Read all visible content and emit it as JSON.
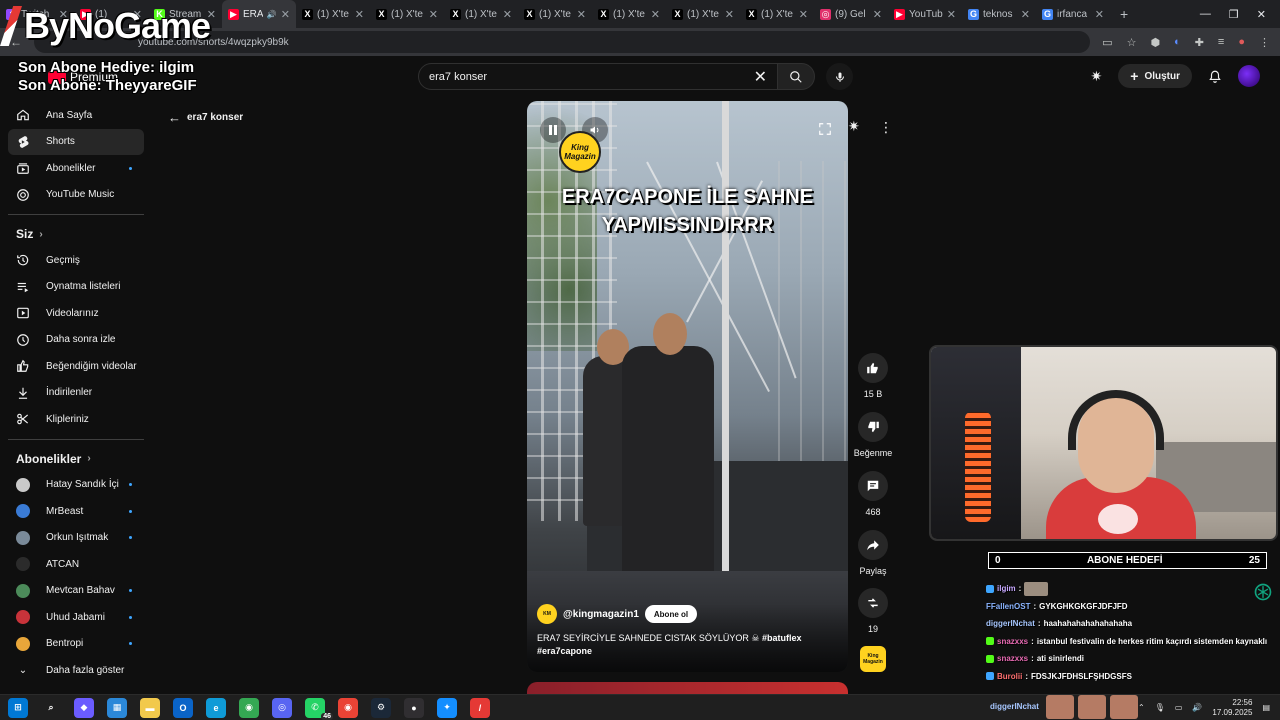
{
  "browser": {
    "tabs": [
      {
        "label": "Twitch",
        "icon": "twitch-icon",
        "color": "#9147ff"
      },
      {
        "label": "(1)",
        "icon": "youtube-icon",
        "color": "#ff0033"
      },
      {
        "label": "Stream",
        "icon": "kick-icon",
        "color": "#53fc18"
      },
      {
        "label": "ERA",
        "icon": "youtube-icon",
        "color": "#ff0033",
        "active": true
      },
      {
        "label": "(1) X'te",
        "icon": "x-icon",
        "color": "#000000"
      },
      {
        "label": "(1) X'te",
        "icon": "x-icon",
        "color": "#000000"
      },
      {
        "label": "(1) X'te",
        "icon": "x-icon",
        "color": "#000000"
      },
      {
        "label": "(1) X'te",
        "icon": "x-icon",
        "color": "#000000"
      },
      {
        "label": "(1) X'te",
        "icon": "x-icon",
        "color": "#000000"
      },
      {
        "label": "(1) X'te",
        "icon": "x-icon",
        "color": "#000000"
      },
      {
        "label": "(1) X'te",
        "icon": "x-icon",
        "color": "#000000"
      },
      {
        "label": "(9) Gel",
        "icon": "instagram-icon",
        "color": "#e1306c"
      },
      {
        "label": "YouTub",
        "icon": "youtube-icon",
        "color": "#ff0033"
      },
      {
        "label": "teknos",
        "icon": "google-icon",
        "color": "#4285f4"
      },
      {
        "label": "irfanca",
        "icon": "google-icon",
        "color": "#4285f4"
      }
    ],
    "url": "youtube.com/shorts/4wqzpky9b9k"
  },
  "overlay": {
    "brand": "ByNoGame",
    "last_donation": "Son Abone Hediye: ilgim",
    "last_sub": "Son Abone: TheyyareGIF"
  },
  "youtube": {
    "logo_text": "Premium",
    "search_value": "era7 konser",
    "create_label": "Oluştur",
    "back_label": "era7 konser",
    "accent": "#ff0033"
  },
  "sidebar": {
    "main": [
      {
        "label": "Ana Sayfa",
        "icon": "home-icon"
      },
      {
        "label": "Shorts",
        "icon": "shorts-icon",
        "active": true
      },
      {
        "label": "Abonelikler",
        "icon": "subscriptions-icon",
        "dot": true
      },
      {
        "label": "YouTube Music",
        "icon": "music-icon"
      }
    ],
    "you_header": "Siz",
    "you": [
      {
        "label": "Geçmiş",
        "icon": "history-icon"
      },
      {
        "label": "Oynatma listeleri",
        "icon": "playlist-icon"
      },
      {
        "label": "Videolarınız",
        "icon": "video-icon"
      },
      {
        "label": "Daha sonra izle",
        "icon": "clock-icon"
      },
      {
        "label": "Beğendiğim videolar",
        "icon": "like-icon"
      },
      {
        "label": "İndirilenler",
        "icon": "download-icon"
      },
      {
        "label": "Klipleriniz",
        "icon": "scissors-icon"
      }
    ],
    "subs_header": "Abonelikler",
    "subs": [
      {
        "label": "Hatay Sandık İçi",
        "color": "#c9c9c9",
        "dot": true
      },
      {
        "label": "MrBeast",
        "color": "#3a7bd5",
        "dot": true
      },
      {
        "label": "Orkun Işıtmak",
        "color": "#7a8a99",
        "dot": true
      },
      {
        "label": "ATCAN",
        "color": "#2b2b2b",
        "dot": false
      },
      {
        "label": "Mevtcan Bahav",
        "color": "#4c8b5a",
        "dot": true
      },
      {
        "label": "Uhud Jabami",
        "color": "#c8333a",
        "dot": true
      },
      {
        "label": "Bentropi",
        "color": "#e8a63a",
        "dot": true
      }
    ],
    "show_more": "Daha fazla göster"
  },
  "short": {
    "overlay_title": "ERA7CAPONE İLE SAHNE YAPMISSINDIRRR",
    "logo_text": "King Magazin",
    "channel": "@kingmagazin1",
    "subscribe_label": "Abone ol",
    "description": "ERA7 SEYİRCİYLE SAHNEDE CISTAK SÖYLÜYOR",
    "hashtag1": "#batuflex",
    "hashtag2": "#era7capone"
  },
  "actions": {
    "likes": "15 B",
    "dislike_label": "Beğenme",
    "comments": "468",
    "share_label": "Paylaş",
    "remix": "19"
  },
  "subgoal": {
    "current": "0",
    "title": "ABONE HEDEFİ",
    "target": "25",
    "progress": 0
  },
  "chat": [
    {
      "user": "ilgim",
      "message": "",
      "user_color": "#c7a8ff",
      "badge": "#3ea6ff",
      "emote": true
    },
    {
      "user": "FFallenOST",
      "message": "GYKGHKGKGFJDFJFD",
      "user_color": "#8ab4ff",
      "badge": ""
    },
    {
      "user": "diggerINchat",
      "message": "haahahahahahahahaha",
      "user_color": "#a7c7ff",
      "badge": ""
    },
    {
      "user": "snazxxs",
      "message": "istanbul festivalin de herkes ritim kaçırdı sistemden kaynaklı",
      "user_color": "#e96ab3",
      "badge": "#53fc18"
    },
    {
      "user": "snazxxs",
      "message": "ati sinirlendi",
      "user_color": "#e96ab3",
      "badge": "#53fc18"
    },
    {
      "user": "Burolii",
      "message": "FDSJKJFDHSLFŞHDGSFS",
      "user_color": "#ff7070",
      "badge": "#3ea6ff"
    }
  ],
  "taskbar": {
    "apps": [
      {
        "name": "windows-start-icon",
        "color": "#0078d4",
        "glyph": "⊞"
      },
      {
        "name": "search-icon",
        "color": "transparent",
        "glyph": "⌕"
      },
      {
        "name": "copilot-icon",
        "color": "#6b5cff",
        "glyph": "◆"
      },
      {
        "name": "store-icon",
        "color": "#2b88d8",
        "glyph": "▦"
      },
      {
        "name": "file-explorer-icon",
        "color": "#f2c94c",
        "glyph": "▬"
      },
      {
        "name": "outlook-icon",
        "color": "#0a64c8",
        "glyph": "O"
      },
      {
        "name": "edge-icon",
        "color": "#0f9bd7",
        "glyph": "e"
      },
      {
        "name": "chrome-icon",
        "color": "#34a853",
        "glyph": "◉"
      },
      {
        "name": "discord-icon",
        "color": "#5865f2",
        "glyph": "◎"
      },
      {
        "name": "whatsapp-icon",
        "color": "#25d366",
        "glyph": "✆",
        "badge": "46"
      },
      {
        "name": "chrome-active-icon",
        "color": "#ea4335",
        "glyph": "◉"
      },
      {
        "name": "steam-icon",
        "color": "#1b2838",
        "glyph": "⚙"
      },
      {
        "name": "obs-icon",
        "color": "#302e31",
        "glyph": "●"
      },
      {
        "name": "battlenet-icon",
        "color": "#148eff",
        "glyph": "✦"
      },
      {
        "name": "bynogame-icon",
        "color": "#e53935",
        "glyph": "/"
      }
    ],
    "chat_user": "diggerINchat",
    "time": "22:56",
    "date": "17.09.2025"
  }
}
